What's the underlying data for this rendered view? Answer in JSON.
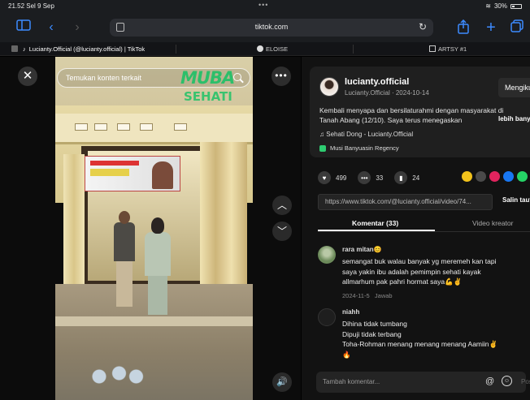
{
  "status": {
    "time": "21.52",
    "date": "Sel 9 Sep",
    "battery": "30%"
  },
  "browser": {
    "url": "tiktok.com",
    "tabs": [
      {
        "label": "Lucianty.Official (@lucianty.official) | TikTok"
      },
      {
        "label": "ELOISE"
      },
      {
        "label": "ARTSY #1"
      }
    ]
  },
  "video": {
    "search_placeholder": "Temukan konten terkait",
    "logo": {
      "line1": "MUBA",
      "line2": "SEHATI"
    }
  },
  "post": {
    "username": "lucianty.official",
    "subtitle": "Lucianty.Official · 2024-10-14",
    "follow_label": "Mengikuti",
    "description_line1": "Kembali menyapa dan bersilaturahmi dengan masyarakat di",
    "description_line2": "Tanah Abang (12/10). Saya terus menegaskan",
    "more_label": "lebih banyak",
    "music": "Sehati Dong - Lucianty.Official",
    "location": "Musi Banyuasin Regency",
    "likes": "499",
    "comments_count": "33",
    "saves": "24",
    "link": "https://www.tiktok.com/@lucianty.official/video/74...",
    "copy_link_label": "Salin tautan"
  },
  "comment_tabs": {
    "comments": "Komentar (33)",
    "creator_videos": "Video kreator"
  },
  "comments": [
    {
      "name": "rara mitan😊",
      "lines": [
        "semangat buk walau banyak yg meremeh kan tapi",
        "saya yakin ibu adalah pemimpin sehati kayak",
        "allmarhum pak pahri hormat saya💪✌"
      ],
      "date": "2024-11-5",
      "reply": "Jawab"
    },
    {
      "name": "niahh",
      "lines": [
        "Dihina tidak tumbang",
        "Dipuji tidak terbang",
        "Toha-Rohman menang menang menang Aamiin✌",
        "🔥"
      ]
    }
  ],
  "composer": {
    "placeholder": "Tambah komentar...",
    "post_label": "Posting"
  },
  "colors": {
    "accent_blue": "#3d8bff",
    "brand_green": "#2cbf6a",
    "panel_bg": "#121212"
  }
}
